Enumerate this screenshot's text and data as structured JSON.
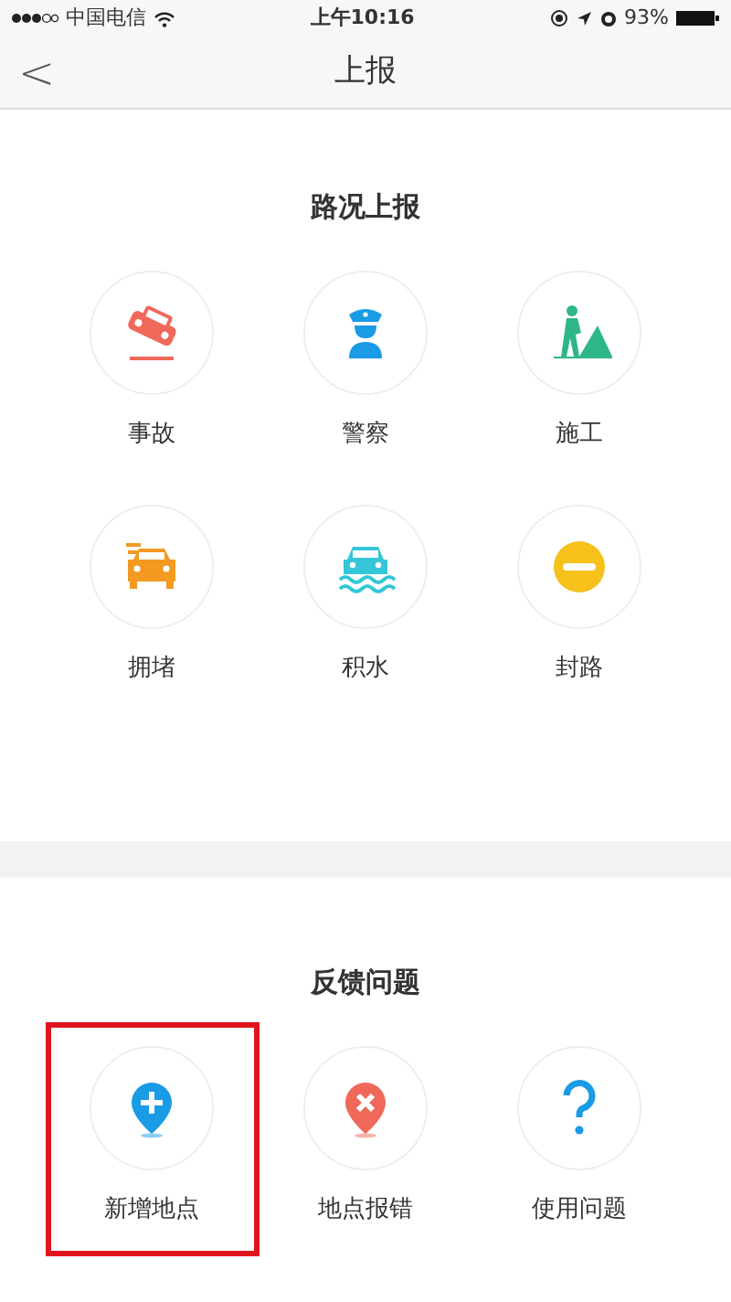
{
  "status_bar": {
    "carrier": "中国电信",
    "time": "上午10:16",
    "battery": "93%"
  },
  "nav": {
    "back": "<",
    "title": "上报"
  },
  "sections": [
    {
      "title": "路况上报",
      "items": [
        {
          "label": "事故",
          "highlighted": false
        },
        {
          "label": "警察",
          "highlighted": false
        },
        {
          "label": "施工",
          "highlighted": false
        },
        {
          "label": "拥堵",
          "highlighted": false
        },
        {
          "label": "积水",
          "highlighted": false
        },
        {
          "label": "封路",
          "highlighted": false
        }
      ]
    },
    {
      "title": "反馈问题",
      "items": [
        {
          "label": "新增地点",
          "highlighted": true
        },
        {
          "label": "地点报错",
          "highlighted": false
        },
        {
          "label": "使用问题",
          "highlighted": false
        }
      ]
    }
  ]
}
